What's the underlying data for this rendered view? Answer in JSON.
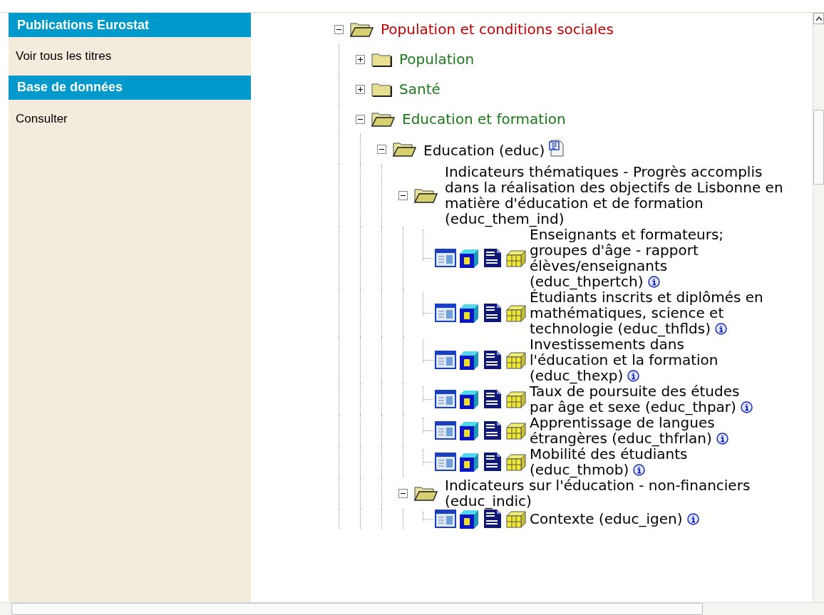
{
  "sidebar": {
    "sections": [
      {
        "title": "Publications Eurostat",
        "items": [
          {
            "label": "Voir tous les titres"
          }
        ]
      },
      {
        "title": "Base de données",
        "items": [
          {
            "label": "Consulter"
          }
        ]
      }
    ]
  },
  "tree": [
    {
      "label": "Population et conditions sociales",
      "kind": "theme",
      "expanded": true,
      "children": [
        {
          "label": "Population",
          "kind": "domain",
          "expanded": false
        },
        {
          "label": "Santé",
          "kind": "domain",
          "expanded": false
        },
        {
          "label": "Education et formation",
          "kind": "domain",
          "expanded": true,
          "children": [
            {
              "label": "Education (educ)",
              "kind": "folder",
              "expanded": true,
              "metadata": true,
              "children": [
                {
                  "label": "Indicateurs thématiques - Progrès accomplis dans la réalisation des objectifs de Lisbonne en matière d'éducation et de formation (educ_them_ind)",
                  "kind": "folder",
                  "expanded": true,
                  "children": [
                    {
                      "label": "Enseignants et formateurs; groupes d'âge - rapport élèves/enseignants (educ_thpertch)",
                      "kind": "dataset"
                    },
                    {
                      "label": "Étudiants inscrits et diplômés en mathématiques, science et technologie (educ_thflds)",
                      "kind": "dataset"
                    },
                    {
                      "label": "Investissements dans l'éducation et la formation (educ_thexp)",
                      "kind": "dataset"
                    },
                    {
                      "label": "Taux de poursuite des études par âge et sexe (educ_thpar)",
                      "kind": "dataset"
                    },
                    {
                      "label": "Apprentissage de langues étrangères (educ_thfrlan)",
                      "kind": "dataset"
                    },
                    {
                      "label": "Mobilité des étudiants (educ_thmob)",
                      "kind": "dataset"
                    }
                  ]
                },
                {
                  "label": "Indicateurs sur l'éducation - non-financiers (educ_indic)",
                  "kind": "folder",
                  "expanded": true,
                  "children": [
                    {
                      "label": "Contexte (educ_igen)",
                      "kind": "dataset"
                    }
                  ]
                }
              ]
            }
          ]
        }
      ]
    }
  ]
}
